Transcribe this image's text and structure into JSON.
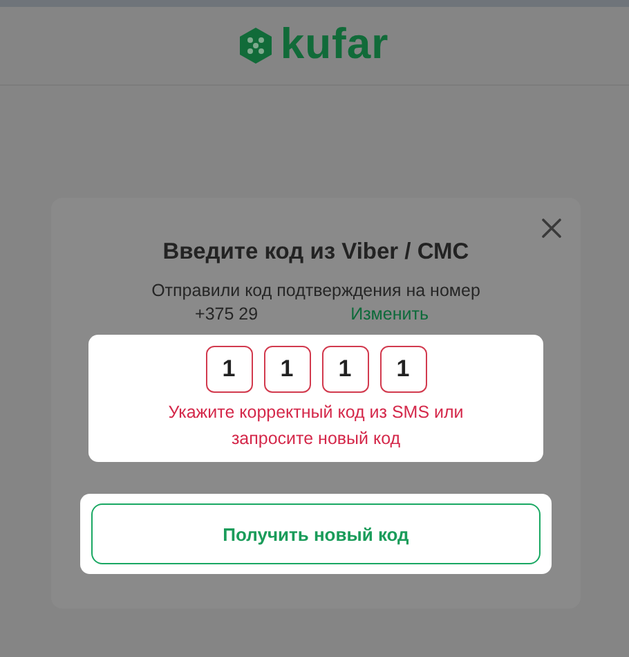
{
  "header": {
    "logo_text": "kufar"
  },
  "dialog": {
    "title": "Введите код из Viber / СМС",
    "message": "Отправили код подтверждения на номер",
    "phone": "+375 29",
    "change_link": "Изменить",
    "code_digits": [
      "1",
      "1",
      "1",
      "1"
    ],
    "code_invalid": true,
    "error": "Укажите корректный код из SMS или запросите новый код",
    "resend_button": "Получить новый код"
  }
}
